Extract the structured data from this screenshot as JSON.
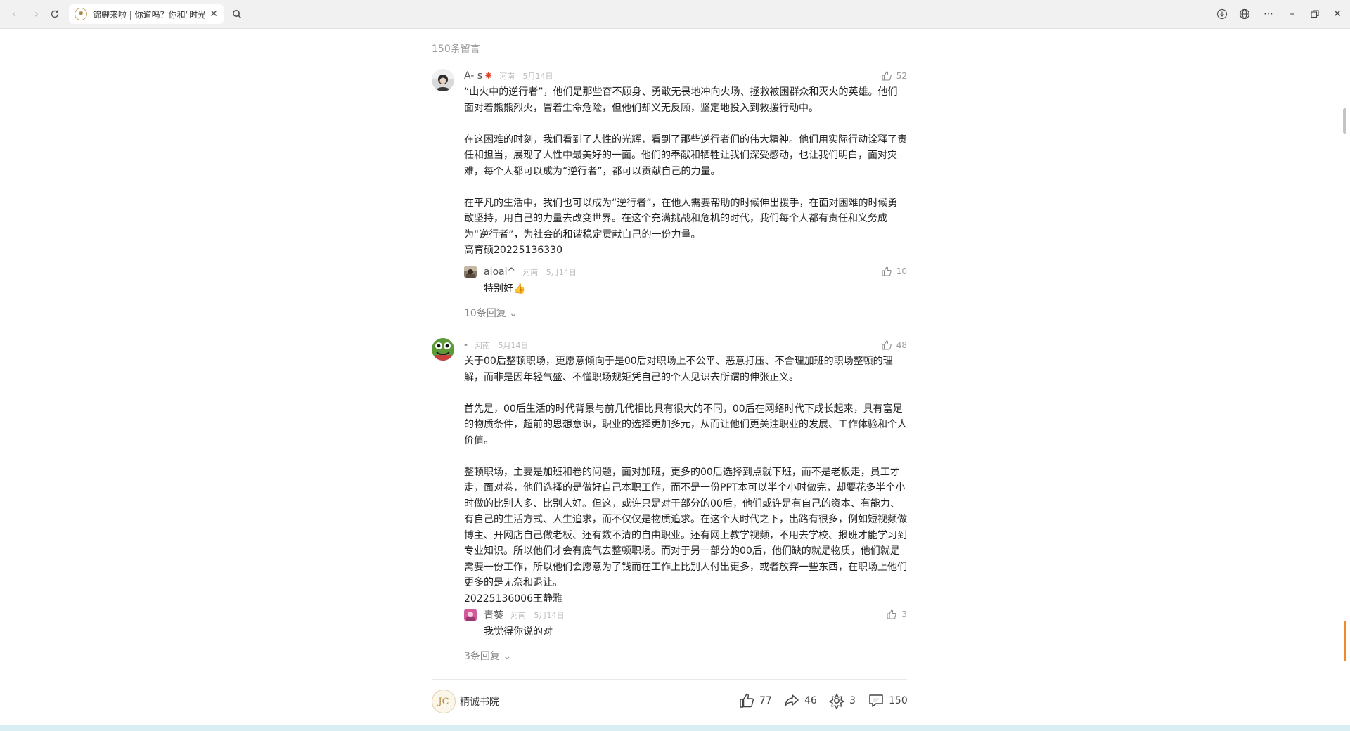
{
  "browser": {
    "tab_title": "锦鲤来啦 | 你道吗？你和\"时光\"",
    "tab_icon": "sun-logo-icon"
  },
  "comments_count_label": "150条留言",
  "comments": [
    {
      "user": "A- s",
      "location": "河南",
      "date": "5月14日",
      "likes": "52",
      "paragraphs": [
        "“山火中的逆行者”，他们是那些奋不顾身、勇敢无畏地冲向火场、拯救被困群众和灭火的英雄。他们面对着熊熊烈火，冒着生命危险，但他们却义无反顾，坚定地投入到救援行动中。",
        "",
        "在这困难的时刻，我们看到了人性的光辉，看到了那些逆行者们的伟大精神。他们用实际行动诠释了责任和担当，展现了人性中最美好的一面。他们的奉献和牺牲让我们深受感动，也让我们明白，面对灾难，每个人都可以成为“逆行者”，都可以贡献自己的力量。",
        "",
        "在平凡的生活中，我们也可以成为“逆行者”，在他人需要帮助的时候伸出援手，在面对困难的时候勇敢坚持，用自己的力量去改变世界。在这个充满挑战和危机的时代，我们每个人都有责任和义务成为“逆行者”，为社会的和谐稳定贡献自己的一份力量。",
        "高育硕20225136330"
      ],
      "reply": {
        "user": "aioai^",
        "location": "河南",
        "date": "5月14日",
        "likes": "10",
        "text": "特别好👍"
      },
      "more_replies": "10条回复 ⌄"
    },
    {
      "user": "-",
      "location": "河南",
      "date": "5月14日",
      "likes": "48",
      "paragraphs": [
        "关于00后整顿职场，更愿意倾向于是00后对职场上不公平、恶意打压、不合理加班的职场整顿的理解，而非是因年轻气盛、不懂职场规矩凭自己的个人见识去所谓的伸张正义。",
        "",
        "首先是，00后生活的时代背景与前几代相比具有很大的不同，00后在网络时代下成长起来，具有富足的物质条件，超前的思想意识，职业的选择更加多元，从而让他们更关注职业的发展、工作体验和个人价值。",
        "",
        "整顿职场，主要是加班和卷的问题，面对加班，更多的00后选择到点就下班，而不是老板走，员工才走，面对卷，他们选择的是做好自己本职工作，而不是一份PPT本可以半个小时做完，却要花多半个小时做的比别人多、比别人好。但这，或许只是对于部分的00后，他们或许是有自己的资本、有能力、有自己的生活方式、人生追求，而不仅仅是物质追求。在这个大时代之下，出路有很多，例如短视频做博主、开网店自己做老板、还有数不清的自由职业。还有网上教学视频，不用去学校、报班才能学习到专业知识。所以他们才会有底气去整顿职场。而对于另一部分的00后，他们缺的就是物质，他们就是需要一份工作，所以他们会愿意为了钱而在工作上比别人付出更多，或者放弃一些东西，在职场上他们更多的是无奈和退让。",
        "20225136006王静雅"
      ],
      "reply": {
        "user": "青葵",
        "location": "河南",
        "date": "5月14日",
        "likes": "3",
        "text": "我觉得你说的对"
      },
      "more_replies": "3条回复 ⌄"
    }
  ],
  "footer": {
    "author": "精诚书院",
    "likes": "77",
    "shares": "46",
    "recommends": "3",
    "comments": "150"
  },
  "colors": {
    "accent": "#f08a2c",
    "muted": "#999999",
    "avatar_green": "#4c8a2e"
  }
}
